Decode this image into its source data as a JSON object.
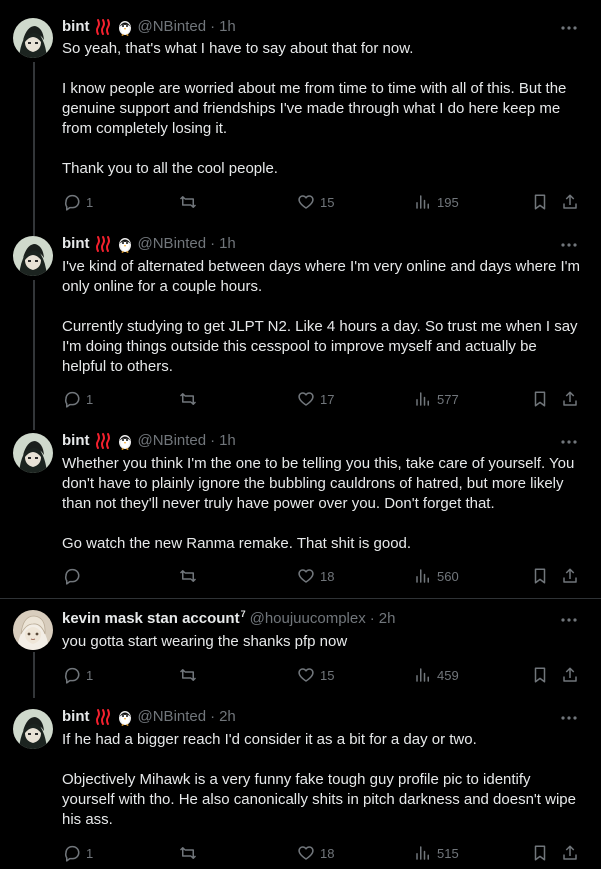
{
  "colors": {
    "background": "#000000",
    "text": "#e7e9ea",
    "muted": "#71767b",
    "divider": "#2f3336"
  },
  "tweets": [
    {
      "display_name": "bint",
      "handle": "@NBinted",
      "time": "1h",
      "emoji": [
        "hot-springs-icon",
        "penguin-icon"
      ],
      "paragraphs": [
        "So yeah, that's what I have to say about that for now.",
        "I know people are worried about me from time to time with all of this. But the genuine support and friendships I've made through what I do here keep me from completely losing it.",
        "Thank you to all the cool people."
      ],
      "replies": "1",
      "reposts": "",
      "likes": "15",
      "views": "195"
    },
    {
      "display_name": "bint",
      "handle": "@NBinted",
      "time": "1h",
      "emoji": [
        "hot-springs-icon",
        "penguin-icon"
      ],
      "paragraphs": [
        "I've kind of alternated between days where I'm very online and days where I'm only online for a couple hours.",
        "Currently studying to get JLPT N2. Like 4 hours a day. So trust me when I say I'm doing things outside this cesspool to improve myself and actually be helpful to others."
      ],
      "replies": "1",
      "reposts": "",
      "likes": "17",
      "views": "577"
    },
    {
      "display_name": "bint",
      "handle": "@NBinted",
      "time": "1h",
      "emoji": [
        "hot-springs-icon",
        "penguin-icon"
      ],
      "paragraphs": [
        "Whether you think I'm the one to be telling you this, take care of yourself. You don't have to plainly ignore the bubbling cauldrons of hatred, but more likely than not they'll never truly have power over you. Don't forget that.",
        "Go watch the new Ranma remake. That shit is good."
      ],
      "replies": "",
      "reposts": "",
      "likes": "18",
      "views": "560"
    },
    {
      "display_name": "kevin mask stan account",
      "name_badge": "7",
      "handle": "@houjuucomplex",
      "time": "2h",
      "emoji": [],
      "paragraphs": [
        "you gotta start wearing the shanks pfp now"
      ],
      "replies": "1",
      "reposts": "",
      "likes": "15",
      "views": "459"
    },
    {
      "display_name": "bint",
      "handle": "@NBinted",
      "time": "2h",
      "emoji": [
        "hot-springs-icon",
        "penguin-icon"
      ],
      "paragraphs": [
        "If he had a bigger reach I'd consider it as a bit for a day or two.",
        "Objectively Mihawk is a very funny fake tough guy profile pic to identify yourself with tho. He also canonically shits in pitch darkness and doesn't wipe his ass."
      ],
      "replies": "1",
      "reposts": "",
      "likes": "18",
      "views": "515"
    }
  ]
}
